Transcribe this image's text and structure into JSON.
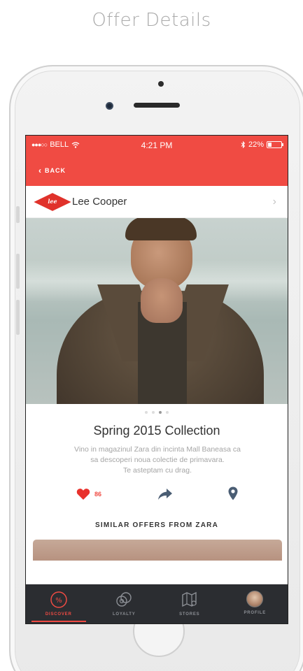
{
  "page": {
    "heading": "Offer Details"
  },
  "status_bar": {
    "carrier": "BELL",
    "time": "4:21 PM",
    "battery": "22%"
  },
  "nav": {
    "back_label": "BACK"
  },
  "brand": {
    "logo_text": "lee",
    "name": "Lee Cooper"
  },
  "offer": {
    "title": "Spring 2015 Collection",
    "description_line1": "Vino in magazinul Zara din incinta Mall Baneasa ca",
    "description_line2": "sa descoperi noua colectie de primavara.",
    "description_line3": "Te asteptam cu drag.",
    "likes": "86",
    "image_count": 4,
    "active_image_index": 2
  },
  "similar": {
    "heading": "SIMILAR OFFERS FROM ZARA"
  },
  "tabs": [
    {
      "label": "DISCOVER",
      "icon": "discount-icon",
      "active": true
    },
    {
      "label": "LOYALTY",
      "icon": "loyalty-icon",
      "active": false
    },
    {
      "label": "STORES",
      "icon": "map-icon",
      "active": false
    },
    {
      "label": "PROFILE",
      "icon": "avatar",
      "active": false
    }
  ],
  "colors": {
    "accent": "#f04b43",
    "tabbar": "#2b2d31",
    "icon": "#4a5d73"
  }
}
